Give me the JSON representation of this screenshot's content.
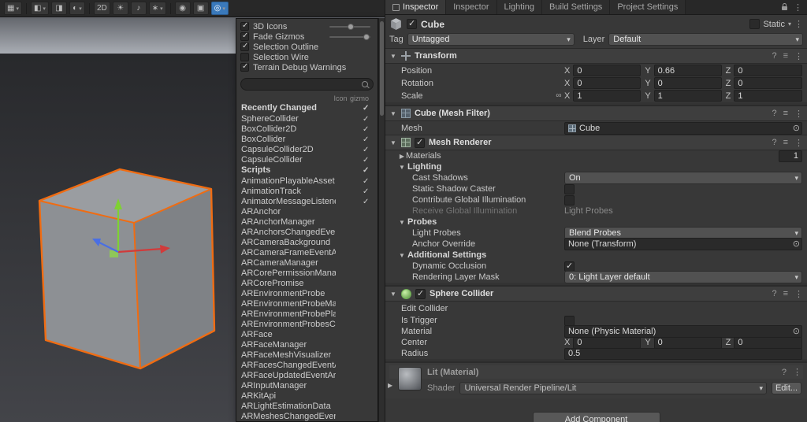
{
  "axes": {
    "x": "X",
    "y": "Y",
    "z": "Z"
  },
  "icons": {
    "fold_open": "▼",
    "fold_closed": "▶",
    "help": "?",
    "preset": "≡",
    "menu": "⋮",
    "picker": "⊙",
    "link": "∞",
    "dots": "⋮"
  },
  "scene": {
    "toolbar": {
      "label_2d": "2D",
      "buttons": [
        "draw-mode",
        "shaded-toggle",
        "wire-toggle",
        "render-mode",
        "2d-toggle",
        "lighting-toggle",
        "audio-toggle",
        "effects",
        "visibility",
        "camera",
        "gizmos"
      ]
    }
  },
  "tabs": [
    {
      "label": "Inspector",
      "active": true
    },
    {
      "label": "Inspector",
      "active": false
    },
    {
      "label": "Lighting",
      "active": false
    },
    {
      "label": "Build Settings",
      "active": false
    },
    {
      "label": "Project Settings",
      "active": false
    }
  ],
  "gizmos": {
    "options": [
      {
        "label": "3D Icons",
        "checked": true,
        "slider": 0.45
      },
      {
        "label": "Fade Gizmos",
        "checked": true,
        "slider": 0.82
      },
      {
        "label": "Selection Outline",
        "checked": true
      },
      {
        "label": "Selection Wire",
        "checked": false
      },
      {
        "label": "Terrain Debug Warnings",
        "checked": true
      }
    ],
    "search_placeholder": "",
    "col_icon": "Icon",
    "col_gizmo": "gizmo",
    "recent": {
      "title": "Recently Changed",
      "gizmo": true,
      "items": [
        {
          "name": "SphereCollider",
          "gizmo": true
        },
        {
          "name": "BoxCollider2D",
          "gizmo": true
        },
        {
          "name": "BoxCollider",
          "gizmo": true
        },
        {
          "name": "CapsuleCollider2D",
          "gizmo": true
        },
        {
          "name": "CapsuleCollider",
          "gizmo": true
        }
      ]
    },
    "scripts": {
      "title": "Scripts",
      "gizmo": true,
      "items": [
        {
          "name": "AnimationPlayableAsset",
          "gizmo": true
        },
        {
          "name": "AnimationTrack",
          "gizmo": true
        },
        {
          "name": "AnimatorMessageListener",
          "icon": true,
          "gizmo": true
        },
        {
          "name": "ARAnchor",
          "icon": true
        },
        {
          "name": "ARAnchorManager",
          "icon": true
        },
        {
          "name": "ARAnchorsChangedEventArgs",
          "icon": true
        },
        {
          "name": "ARCameraBackground",
          "icon": true
        },
        {
          "name": "ARCameraFrameEventArgs",
          "icon": true
        },
        {
          "name": "ARCameraManager",
          "icon": true
        },
        {
          "name": "ARCorePermissionManager",
          "icon": true
        },
        {
          "name": "ARCorePromise",
          "icon": true
        },
        {
          "name": "AREnvironmentProbe",
          "icon": true
        },
        {
          "name": "AREnvironmentProbeManager",
          "icon": true
        },
        {
          "name": "AREnvironmentProbePlacer",
          "icon": true
        },
        {
          "name": "AREnvironmentProbesChanged",
          "icon": true
        },
        {
          "name": "ARFace",
          "icon": true
        },
        {
          "name": "ARFaceManager",
          "icon": true
        },
        {
          "name": "ARFaceMeshVisualizer",
          "icon": true
        },
        {
          "name": "ARFacesChangedEventArgs",
          "icon": true
        },
        {
          "name": "ARFaceUpdatedEventArgs",
          "icon": true
        },
        {
          "name": "ARInputManager",
          "icon": true
        },
        {
          "name": "ARKitApi",
          "icon": true
        },
        {
          "name": "ARLightEstimationData",
          "icon": true
        },
        {
          "name": "ARMeshesChangedEventArgs",
          "icon": true
        }
      ]
    }
  },
  "inspector": {
    "name": "Cube",
    "static_label": "Static",
    "tag_label": "Tag",
    "tag_value": "Untagged",
    "layer_label": "Layer",
    "layer_value": "Default",
    "transform": {
      "title": "Transform",
      "position": {
        "label": "Position",
        "x": "0",
        "y": "0.66",
        "z": "0"
      },
      "rotation": {
        "label": "Rotation",
        "x": "0",
        "y": "0",
        "z": "0"
      },
      "scale": {
        "label": "Scale",
        "x": "1",
        "y": "1",
        "z": "1"
      }
    },
    "mesh_filter": {
      "title": "Cube (Mesh Filter)",
      "mesh_label": "Mesh",
      "mesh_value": "Cube"
    },
    "mesh_renderer": {
      "title": "Mesh Renderer",
      "materials_label": "Materials",
      "materials_count": "1",
      "lighting_title": "Lighting",
      "cast_shadows_label": "Cast Shadows",
      "cast_shadows_value": "On",
      "static_shadow_label": "Static Shadow Caster",
      "contribute_gi_label": "Contribute Global Illumination",
      "receive_gi_label": "Receive Global Illumination",
      "receive_gi_value": "Light Probes",
      "probes_title": "Probes",
      "light_probes_label": "Light Probes",
      "light_probes_value": "Blend Probes",
      "anchor_label": "Anchor Override",
      "anchor_value": "None (Transform)",
      "additional_title": "Additional Settings",
      "dyn_occ_label": "Dynamic Occlusion",
      "rlm_label": "Rendering Layer Mask",
      "rlm_value": "0: Light Layer default"
    },
    "sphere_collider": {
      "title": "Sphere Collider",
      "edit_label": "Edit Collider",
      "trigger_label": "Is Trigger",
      "material_label": "Material",
      "material_value": "None (Physic Material)",
      "center": {
        "label": "Center",
        "x": "0",
        "y": "0",
        "z": "0"
      },
      "radius_label": "Radius",
      "radius_value": "0.5"
    },
    "material": {
      "title": "Lit (Material)",
      "shader_label": "Shader",
      "shader_value": "Universal Render Pipeline/Lit",
      "edit_button": "Edit..."
    },
    "add_component": "Add Component"
  }
}
